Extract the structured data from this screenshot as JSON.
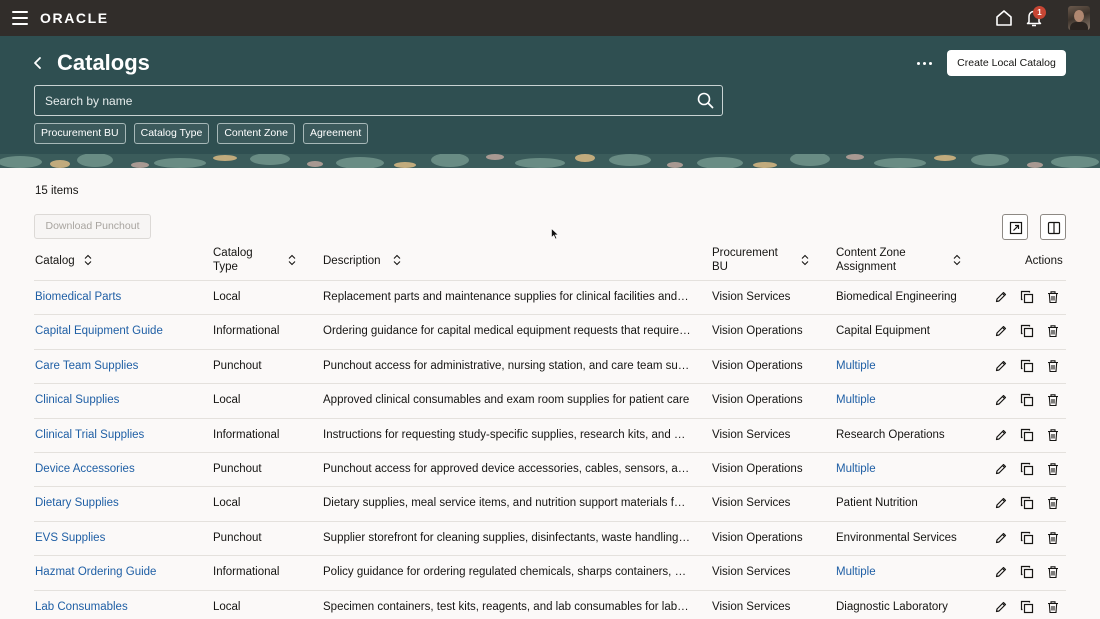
{
  "topbar": {
    "brand": "ORACLE",
    "notifications_count": "1",
    "icons": [
      "menu-icon",
      "home-icon",
      "bell-icon",
      "user-avatar"
    ]
  },
  "header": {
    "title": "Catalogs",
    "create_button": "Create Local Catalog",
    "search_placeholder": "Search by name",
    "filters": [
      "Procurement BU",
      "Catalog Type",
      "Content Zone",
      "Agreement"
    ]
  },
  "content": {
    "item_count": "15 items",
    "download_button": "Download Punchout"
  },
  "table": {
    "columns": {
      "catalog": "Catalog",
      "catalog_type_1": "Catalog",
      "catalog_type_2": "Type",
      "description": "Description",
      "bu_1": "Procurement",
      "bu_2": "BU",
      "zone_1": "Content Zone",
      "zone_2": "Assignment",
      "actions": "Actions"
    },
    "rows": [
      {
        "catalog": "Biomedical Parts",
        "type": "Local",
        "description": "Replacement parts and maintenance supplies for clinical facilities and equipment",
        "bu": "Vision Services",
        "zone": "Biomedical Engineering",
        "zone_link": false
      },
      {
        "catalog": "Capital Equipment Guide",
        "type": "Informational",
        "description": "Ordering guidance for capital medical equipment requests that require approval",
        "bu": "Vision Operations",
        "zone": "Capital Equipment",
        "zone_link": false
      },
      {
        "catalog": "Care Team Supplies",
        "type": "Punchout",
        "description": "Punchout access for administrative, nursing station, and care team supplies",
        "bu": "Vision Operations",
        "zone": "Multiple",
        "zone_link": true
      },
      {
        "catalog": "Clinical Supplies",
        "type": "Local",
        "description": "Approved clinical consumables and exam room supplies for patient care",
        "bu": "Vision Operations",
        "zone": "Multiple",
        "zone_link": true
      },
      {
        "catalog": "Clinical Trial Supplies",
        "type": "Informational",
        "description": "Instructions for requesting study-specific supplies, research kits, and materials",
        "bu": "Vision Services",
        "zone": "Research Operations",
        "zone_link": false
      },
      {
        "catalog": "Device Accessories",
        "type": "Punchout",
        "description": "Punchout access for approved device accessories, cables, sensors, and parts",
        "bu": "Vision Operations",
        "zone": "Multiple",
        "zone_link": true
      },
      {
        "catalog": "Dietary Supplies",
        "type": "Local",
        "description": "Dietary supplies, meal service items, and nutrition support materials for patients",
        "bu": "Vision Services",
        "zone": "Patient Nutrition",
        "zone_link": false
      },
      {
        "catalog": "EVS Supplies",
        "type": "Punchout",
        "description": "Supplier storefront for cleaning supplies, disinfectants, waste handling products",
        "bu": "Vision Operations",
        "zone": "Environmental Services",
        "zone_link": false
      },
      {
        "catalog": "Hazmat Ordering Guide",
        "type": "Informational",
        "description": "Policy guidance for ordering regulated chemicals, sharps containers, and waste",
        "bu": "Vision Services",
        "zone": "Multiple",
        "zone_link": true
      },
      {
        "catalog": "Lab Consumables",
        "type": "Local",
        "description": "Specimen containers, test kits, reagents, and lab consumables for laboratory use",
        "bu": "Vision Services",
        "zone": "Diagnostic Laboratory",
        "zone_link": false
      }
    ]
  },
  "colors": {
    "topbar": "#312d2a",
    "header": "#2f4f51",
    "link": "#1f5fa5",
    "badge": "#c74634",
    "background": "#fbf9f8"
  }
}
